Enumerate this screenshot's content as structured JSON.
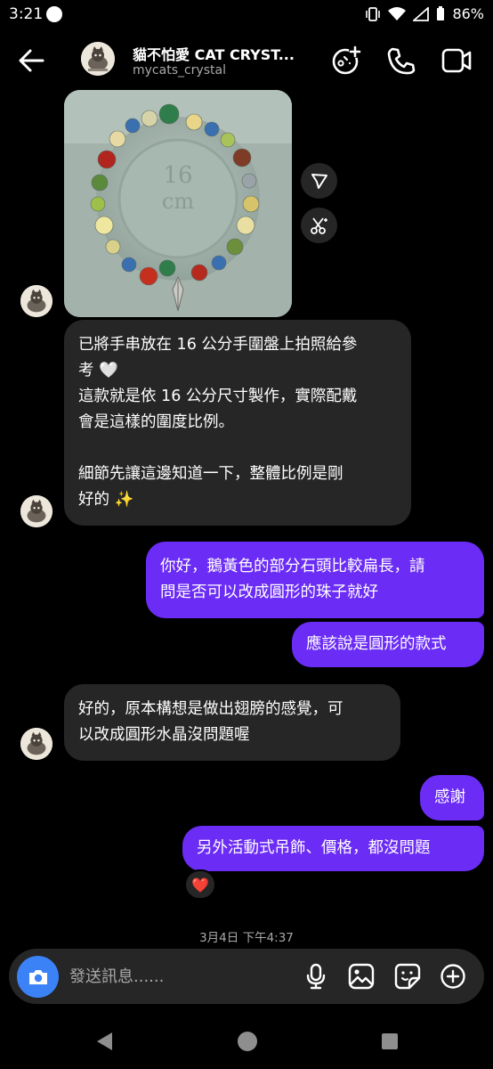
{
  "status_bar": {
    "time": "3:21",
    "battery": "86%"
  },
  "header": {
    "title": "貓不怕愛 CAT CRYST...",
    "username": "mycats_crystal"
  },
  "photo": {
    "stamp_text": "16 cm"
  },
  "messages": [
    {
      "side": "received",
      "lines": [
        "已將手串放在 16 公分手圍盤上拍照給參",
        "考 🤍",
        "這款就是依 16 公分尺寸製作，實際配戴",
        "會是這樣的圍度比例。",
        "",
        "細節先讓這邊知道一下，整體比例是剛",
        "好的 ✨"
      ]
    },
    {
      "side": "sent",
      "lines": [
        "你好，鵝黃色的部分石頭比較扁長，請",
        "問是否可以改成圓形的珠子就好"
      ]
    },
    {
      "side": "sent",
      "lines": [
        "應該說是圓形的款式"
      ]
    },
    {
      "side": "received",
      "lines": [
        "好的，原本構想是做出翅膀的感覺，可",
        "以改成圓形水晶沒問題喔"
      ]
    },
    {
      "side": "sent",
      "lines": [
        "感謝"
      ]
    },
    {
      "side": "sent",
      "lines": [
        "另外活動式吊飾、價格，都沒問題"
      ]
    }
  ],
  "reaction": "❤️",
  "timestamp": "3月4日 下午4:37",
  "composer": {
    "placeholder": "發送訊息......"
  },
  "icons": {
    "back": "arrow-left-icon",
    "effects": "sparkle-plus-icon",
    "call": "phone-icon",
    "video": "video-camera-icon",
    "share": "paper-plane-icon",
    "remix": "scissors-icon",
    "camera": "camera-icon",
    "mic": "microphone-icon",
    "gallery": "gallery-icon",
    "sticker": "sticker-icon",
    "plus": "plus-circle-icon"
  },
  "colors": {
    "sent_bubble": "#6b2cf5",
    "received_bubble": "#262626",
    "camera_button": "#3b82f6"
  }
}
